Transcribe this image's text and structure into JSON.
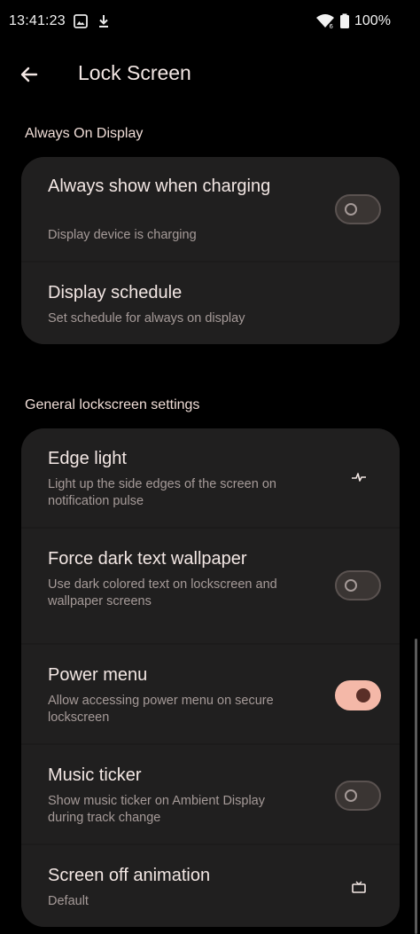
{
  "status_bar": {
    "time": "13:41:23",
    "battery": "100%"
  },
  "app_bar": {
    "title": "Lock Screen"
  },
  "sections": [
    {
      "header": "Always On Display",
      "items": [
        {
          "title": "Always show when charging",
          "summary": "Display device is charging",
          "control": "toggle",
          "state": "off"
        },
        {
          "title": "Display schedule",
          "summary": "Set schedule for always on display",
          "control": "none"
        }
      ]
    },
    {
      "header": "General lockscreen settings",
      "items": [
        {
          "title": "Edge light",
          "summary": "Light up the side edges of the screen on notification pulse",
          "control": "icon",
          "icon": "pulse-icon"
        },
        {
          "title": "Force dark text wallpaper",
          "summary": "Use dark colored text on lockscreen and wallpaper screens",
          "control": "toggle",
          "state": "off"
        },
        {
          "title": "Power menu",
          "summary": "Allow accessing power menu on secure lockscreen",
          "control": "toggle",
          "state": "on"
        },
        {
          "title": "Music ticker",
          "summary": "Show music ticker on Ambient Display during track change",
          "control": "toggle",
          "state": "off"
        },
        {
          "title": "Screen off animation",
          "summary": "Default",
          "control": "icon",
          "icon": "tv-icon"
        }
      ]
    }
  ],
  "colors": {
    "background": "#000000",
    "card": "#201f1f",
    "accent": "#f4b8a8",
    "title_text": "#f3e7e4",
    "summary_text": "#a59a98"
  }
}
